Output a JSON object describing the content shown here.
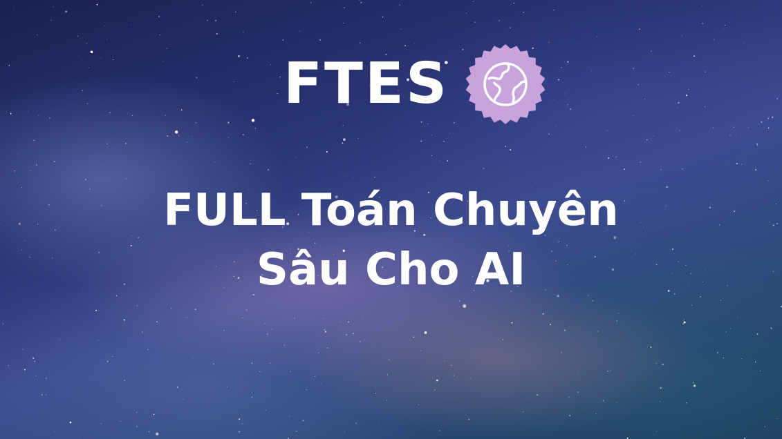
{
  "brand": {
    "name": "FTES",
    "badge_color": "#c9a3dc",
    "badge_icon": "globe-icon"
  },
  "title": {
    "line1": "FULL Toán Chuyên",
    "line2": "Sâu Cho AI"
  },
  "colors": {
    "text": "#ffffff",
    "background": "#2a3575"
  }
}
